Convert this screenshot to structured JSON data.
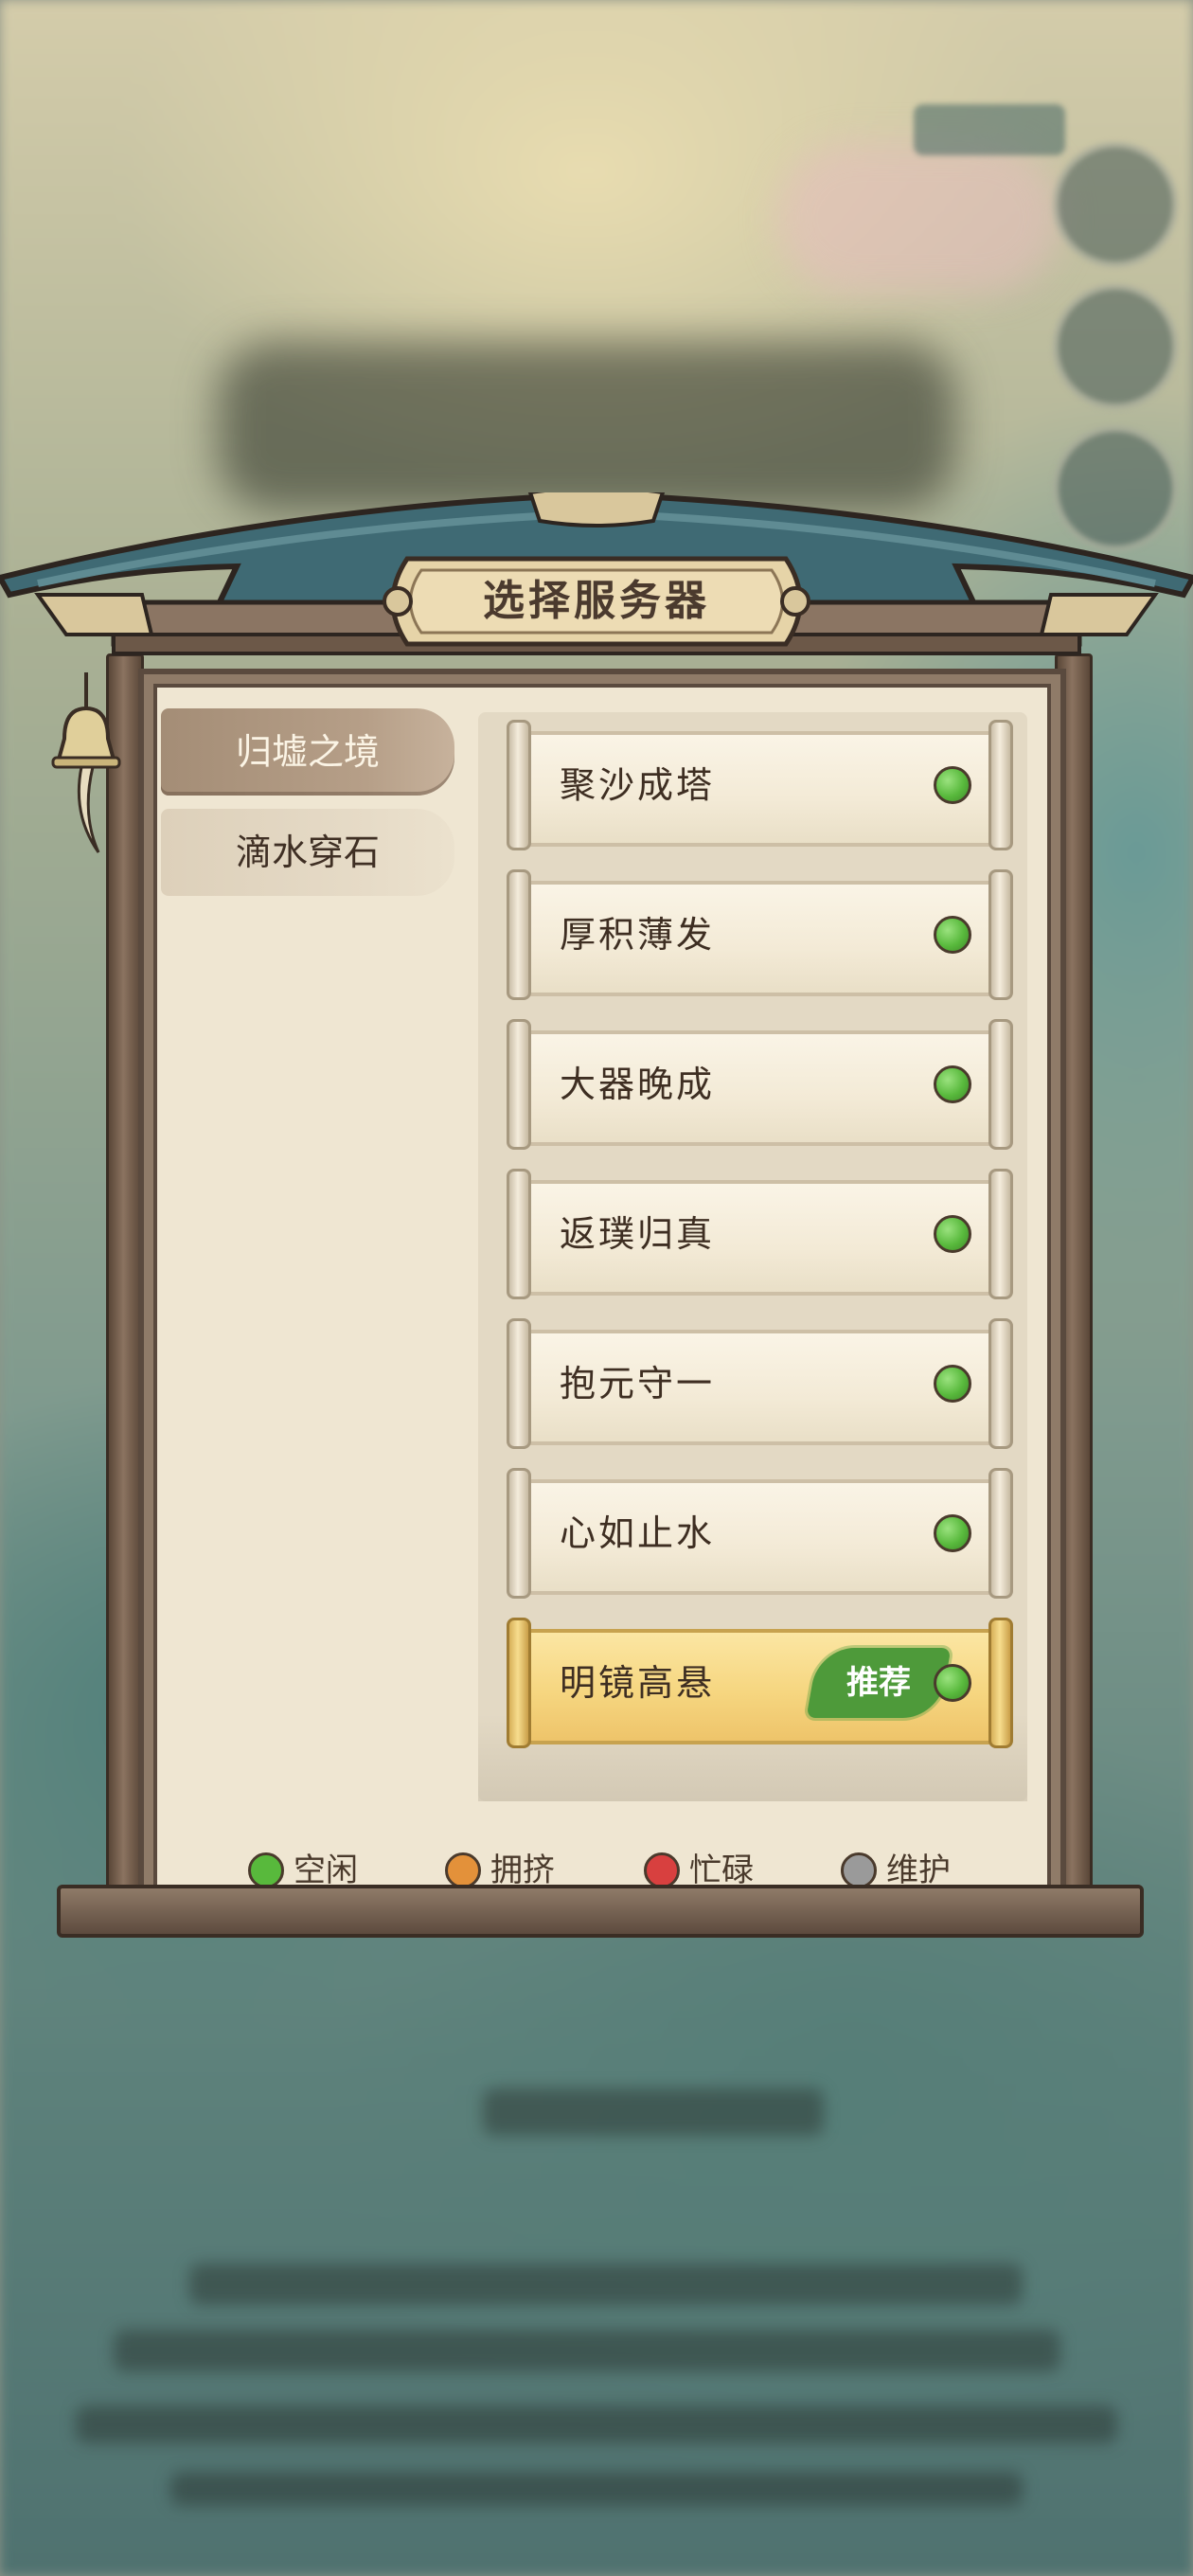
{
  "dialog": {
    "title": "选择服务器"
  },
  "regions": [
    {
      "label": "归墟之境",
      "selected": true
    },
    {
      "label": "滴水穿石",
      "selected": false
    }
  ],
  "servers": [
    {
      "name": "聚沙成塔",
      "status": "空闲"
    },
    {
      "name": "厚积薄发",
      "status": "空闲"
    },
    {
      "name": "大器晚成",
      "status": "空闲"
    },
    {
      "name": "返璞归真",
      "status": "空闲"
    },
    {
      "name": "抱元守一",
      "status": "空闲"
    },
    {
      "name": "心如止水",
      "status": "空闲"
    },
    {
      "name": "明镜高悬",
      "status": "空闲",
      "badge": "推荐"
    }
  ],
  "legend": [
    {
      "label": "空闲",
      "color": "#58b93c"
    },
    {
      "label": "拥挤",
      "color": "#e3913a"
    },
    {
      "label": "忙碌",
      "color": "#d8403f"
    },
    {
      "label": "维护",
      "color": "#9a9a9a"
    }
  ],
  "colors": {
    "idle": "#58b93c",
    "recommended_badge": "#4e9a3a",
    "selected_scroll": "#f6d680"
  }
}
